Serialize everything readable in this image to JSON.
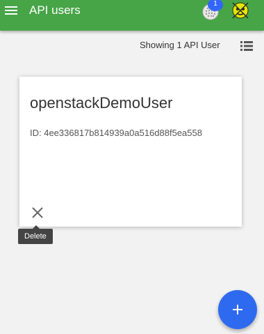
{
  "header": {
    "title": "API users",
    "notification_count": "1",
    "menu_icon": "hamburger-menu-icon",
    "globe_icon": "globe-icon",
    "avatar_icon": "user-avatar-icon",
    "bar_color": "#47a447"
  },
  "toolbar": {
    "count_text": "Showing 1 API User",
    "view_icon": "list-view-icon"
  },
  "card": {
    "name": "openstackDemoUser",
    "id_text": "ID: 4ee336817b814939a0a516d88f5ea558",
    "delete_icon": "close-icon",
    "delete_tooltip": "Delete"
  },
  "fab": {
    "icon": "plus-icon",
    "color": "#2e6af0"
  }
}
